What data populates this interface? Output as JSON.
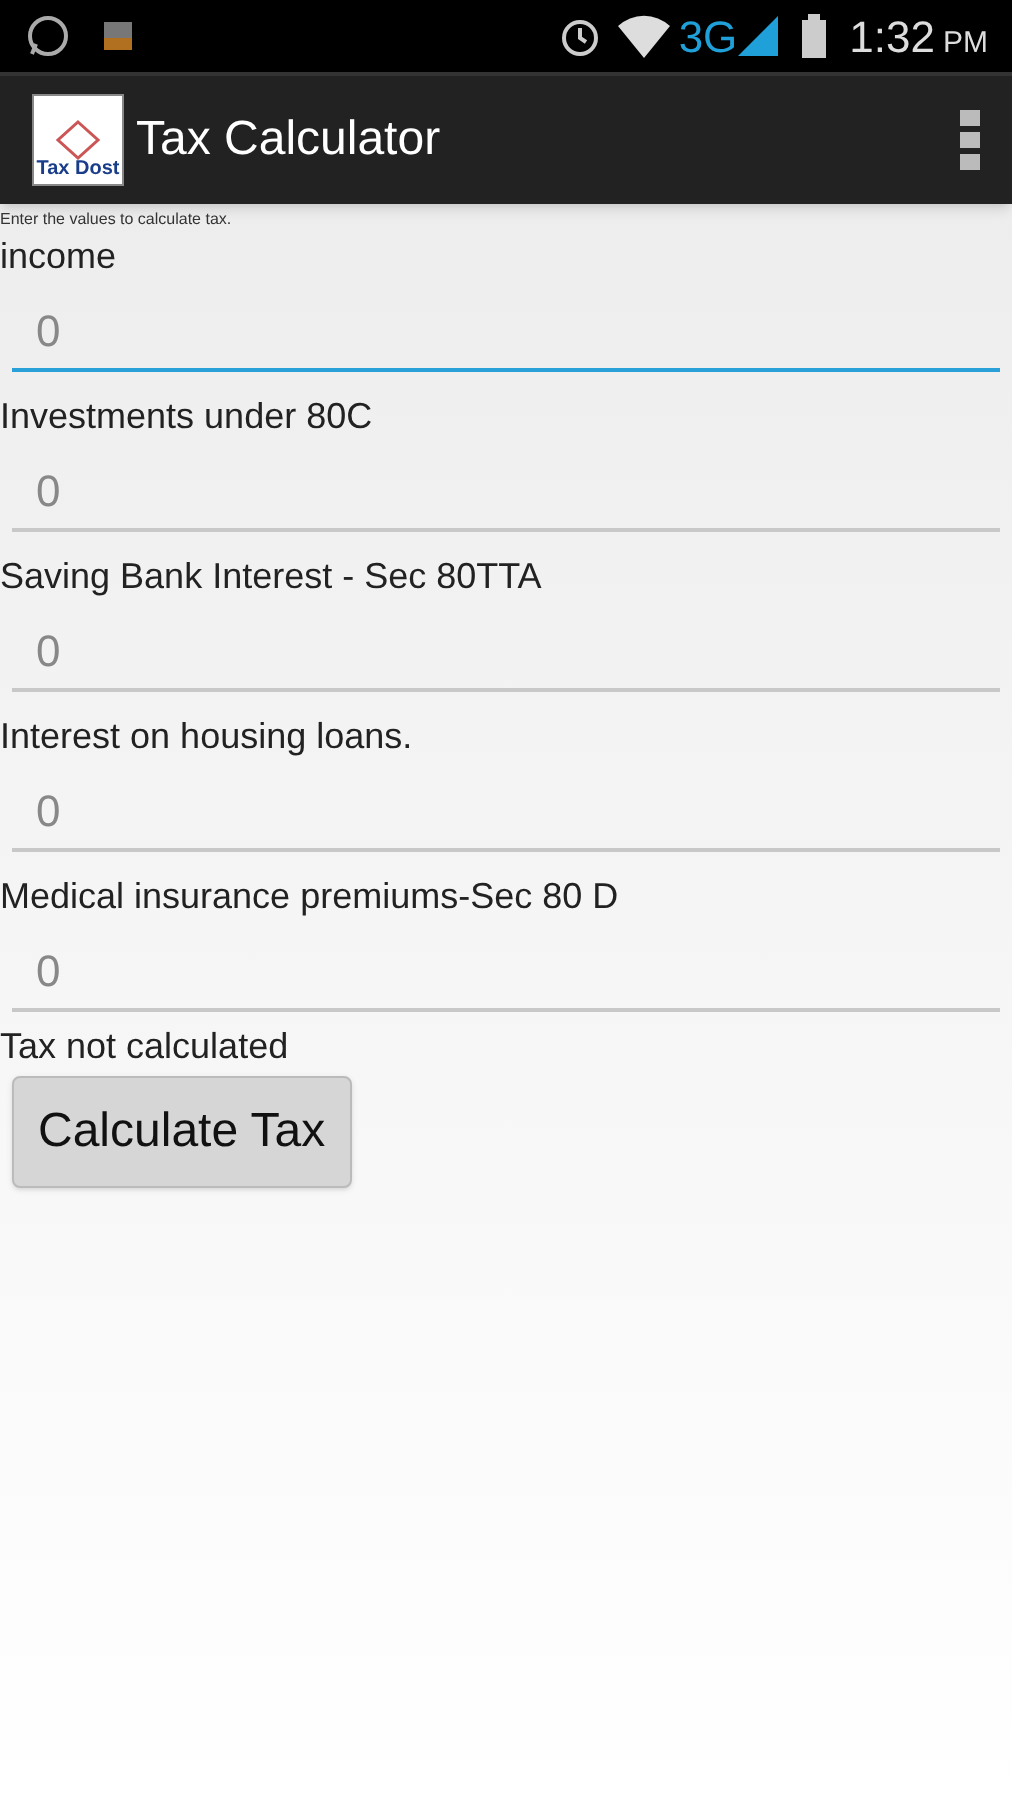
{
  "status_bar": {
    "network": "3G",
    "time": "1:32",
    "ampm": "PM"
  },
  "app_bar": {
    "logo_text": "Tax Dost",
    "title": "Tax Calculator"
  },
  "instructions": "Enter the values to calculate tax.",
  "fields": [
    {
      "label": "income",
      "placeholder": "0",
      "focused": true
    },
    {
      "label": "Investments under 80C",
      "placeholder": "0",
      "focused": false
    },
    {
      "label": "Saving Bank Interest - Sec 80TTA",
      "placeholder": "0",
      "focused": false
    },
    {
      "label": "Interest on housing loans.",
      "placeholder": "0",
      "focused": false
    },
    {
      "label": "Medical insurance premiums-Sec 80 D",
      "placeholder": "0",
      "focused": false
    }
  ],
  "result": "Tax not calculated",
  "button": "Calculate Tax"
}
